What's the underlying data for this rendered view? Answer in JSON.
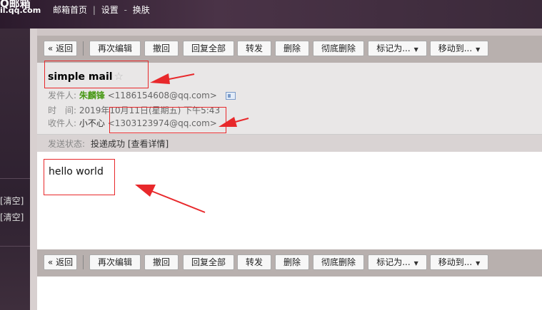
{
  "header": {
    "logo_top": "Q邮箱",
    "logo_sub": "il.qq.com",
    "nav": [
      "邮箱首页",
      "设置",
      "换肤"
    ],
    "nav_sep": "|",
    "nav_sep2": "-"
  },
  "sidebar": {
    "clear1": "[清空]",
    "clear2": "[清空]"
  },
  "toolbar": {
    "back": "« 返回",
    "reedit": "再次编辑",
    "recall": "撤回",
    "reply_all": "回复全部",
    "forward": "转发",
    "delete": "删除",
    "perm_delete": "彻底删除",
    "mark_as": "标记为...",
    "move_to": "移动到..."
  },
  "mail": {
    "subject": "simple mail",
    "star": "☆",
    "from_label": "发件人:",
    "from_name": "朱麟锋",
    "from_addr": "<1186154608@qq.com>",
    "time_label": "时　间:",
    "time_value": "2019年10月11日(星期五) 下午5:43",
    "to_label": "收件人:",
    "to_name": "小不心",
    "to_addr": "<1303123974@qq.com>",
    "status_label": "发送状态:",
    "status_value": "投递成功 [查看详情]",
    "body": "hello world"
  },
  "colors": {
    "annotation": "#e8282b",
    "sender": "#4a9a18",
    "toolbar_bg": "#b8b0ae",
    "header_bg": "#e9e7e7"
  }
}
